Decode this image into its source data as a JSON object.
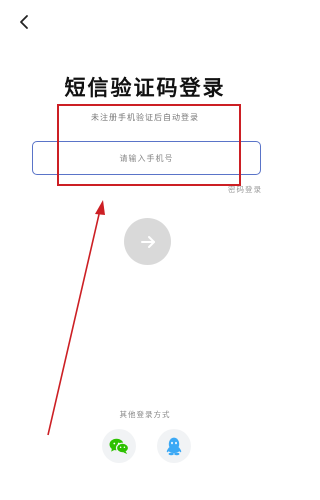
{
  "header": {
    "back_icon": "chevron-left-icon"
  },
  "main": {
    "title": "短信验证码登录",
    "subtitle": "未注册手机验证后自动登录",
    "phone_placeholder": "请输入手机号",
    "password_login_label": "密码登录",
    "submit_icon": "arrow-right-icon"
  },
  "footer": {
    "other_methods_label": "其他登录方式",
    "methods": [
      {
        "name": "wechat",
        "icon": "wechat-icon"
      },
      {
        "name": "qq",
        "icon": "qq-icon"
      }
    ]
  },
  "colors": {
    "input_border": "#5a74c8",
    "annotation": "#cc1f24",
    "wechat": "#2dc100",
    "qq": "#3ca9f5",
    "submit_bg": "#d9d9d9"
  }
}
